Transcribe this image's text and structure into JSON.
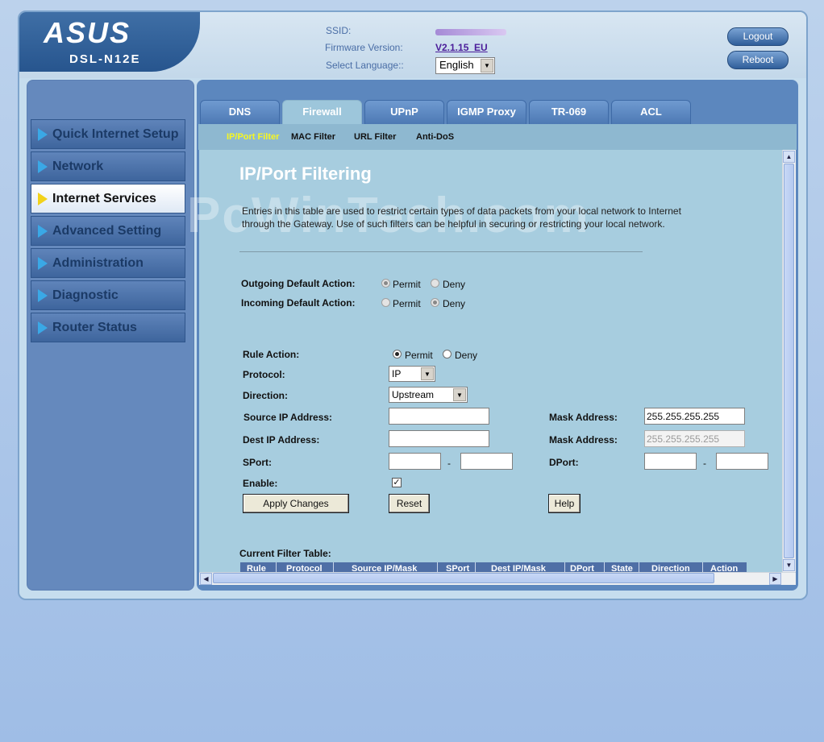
{
  "header": {
    "brand": "ASUS",
    "model": "DSL-N12E",
    "ssid_label": "SSID:",
    "firmware_label": "Firmware Version:",
    "firmware_value": "V2.1.15_EU",
    "language_label": "Select Language::",
    "language_value": "English",
    "logout_label": "Logout",
    "reboot_label": "Reboot"
  },
  "sidebar": {
    "items": [
      {
        "label": "Quick Internet Setup"
      },
      {
        "label": "Network"
      },
      {
        "label": "Internet Services"
      },
      {
        "label": "Advanced Setting"
      },
      {
        "label": "Administration"
      },
      {
        "label": "Diagnostic"
      },
      {
        "label": "Router Status"
      }
    ],
    "active_index": 2
  },
  "tabs": [
    {
      "label": "DNS"
    },
    {
      "label": "Firewall"
    },
    {
      "label": "UPnP"
    },
    {
      "label": "IGMP Proxy"
    },
    {
      "label": "TR-069"
    },
    {
      "label": "ACL"
    }
  ],
  "subtabs": [
    {
      "label": "IP/Port Filter"
    },
    {
      "label": "MAC Filter"
    },
    {
      "label": "URL Filter"
    },
    {
      "label": "Anti-DoS"
    }
  ],
  "page": {
    "title": "IP/Port Filtering",
    "watermark": "PcWinTech.com",
    "description": "Entries in this table are used to restrict certain types of data packets from your local network to Internet through the Gateway. Use of such filters can be helpful in securing or restricting your local network."
  },
  "defaults": {
    "outgoing_label": "Outgoing Default Action:",
    "incoming_label": "Incoming Default Action:",
    "permit": "Permit",
    "deny": "Deny"
  },
  "rule": {
    "action_label": "Rule Action:",
    "permit": "Permit",
    "deny": "Deny",
    "protocol_label": "Protocol:",
    "protocol_value": "IP",
    "direction_label": "Direction:",
    "direction_value": "Upstream",
    "source_ip_label": "Source IP Address:",
    "source_mask_label": "Mask Address:",
    "source_mask_value": "255.255.255.255",
    "dest_ip_label": "Dest IP Address:",
    "dest_mask_label": "Mask Address:",
    "dest_mask_value": "255.255.255.255",
    "sport_label": "SPort:",
    "dport_label": "DPort:",
    "dash": "-",
    "enable_label": "Enable:",
    "apply_label": "Apply Changes",
    "reset_label": "Reset",
    "help_label": "Help"
  },
  "table": {
    "title": "Current Filter Table:",
    "columns": [
      "Rule",
      "Protocol",
      "Source IP/Mask",
      "SPort",
      "Dest IP/Mask",
      "DPort",
      "State",
      "Direction",
      "Action"
    ]
  }
}
